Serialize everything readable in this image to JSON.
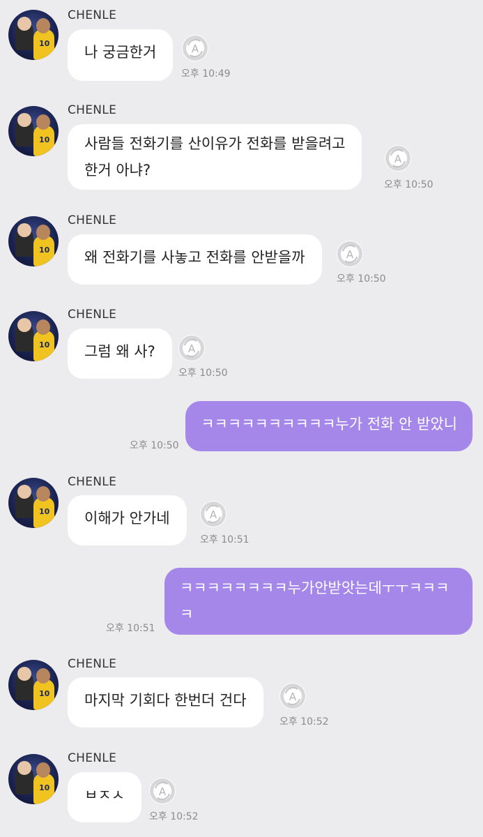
{
  "chat": {
    "time_prefix": "오후",
    "messages": [
      {
        "sender": "CHENLE",
        "text": "나 궁금한거",
        "time": "오후 10:49"
      },
      {
        "sender": "CHENLE",
        "text": "사람들 전화기를 산이유가 전화를 받을려고",
        "text2": "한거 아냐?",
        "time": "오후 10:50"
      },
      {
        "sender": "CHENLE",
        "text": "왜 전화기를 사놓고 전화를 안받을까",
        "time": "오후 10:50"
      },
      {
        "sender": "CHENLE",
        "text": "그럼 왜 사?",
        "time": "오후 10:50"
      },
      {
        "sender": "me",
        "text": "ㅋㅋㅋㅋㅋㅋㅋㅋㅋㅋ누가 전화 안 받았니",
        "time": "오후 10:50"
      },
      {
        "sender": "CHENLE",
        "text": "이해가 안가네",
        "time": "오후 10:51"
      },
      {
        "sender": "me",
        "text": "ㅋㅋㅋㅋㅋㅋㅋㅋ누가안받앗는데ㅜㅜㅋㅋㅋ",
        "text2": "ㅋ",
        "time": "오후 10:51"
      },
      {
        "sender": "CHENLE",
        "text": "마지막 기회다 한번더 건다",
        "time": "오후 10:52"
      },
      {
        "sender": "CHENLE",
        "text": "ㅂㅈㅅ",
        "time": "오후 10:52"
      }
    ]
  },
  "colors": {
    "background": "#ececee",
    "my_bubble": "#a487e8",
    "their_bubble": "#ffffff"
  },
  "icons": {
    "translate": "circular-arrows-A-icon",
    "avatar": "profile-photo"
  }
}
